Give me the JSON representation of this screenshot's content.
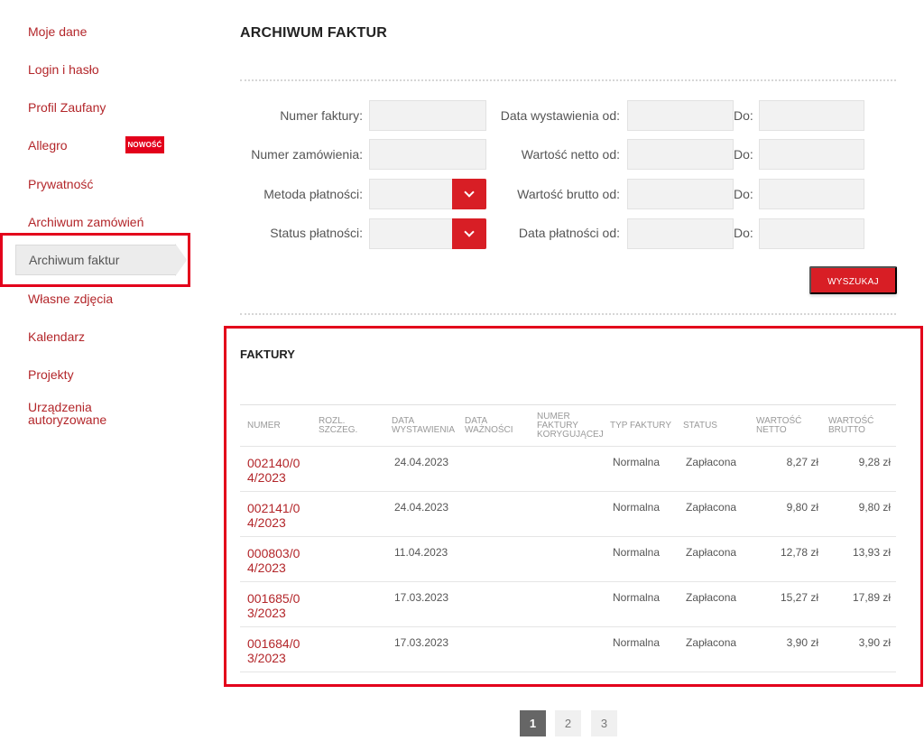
{
  "sidebar": {
    "items": [
      {
        "label": "Moje dane"
      },
      {
        "label": "Login i hasło"
      },
      {
        "label": "Profil Zaufany"
      },
      {
        "label": "Allegro",
        "badge": "NOWOŚĆ"
      },
      {
        "label": "Prywatność"
      },
      {
        "label": "Archiwum zamówień"
      },
      {
        "label": "Archiwum faktur",
        "active": true
      },
      {
        "label": "Własne zdjęcia"
      },
      {
        "label": "Kalendarz"
      },
      {
        "label": "Projekty"
      },
      {
        "label": "Urządzenia autoryzowane"
      }
    ]
  },
  "main": {
    "title": "ARCHIWUM FAKTUR",
    "filters": {
      "invoice_number": {
        "label": "Numer faktury:",
        "value": ""
      },
      "order_number": {
        "label": "Numer zamówienia:",
        "value": ""
      },
      "payment_method": {
        "label": "Metoda płatności:",
        "value": ""
      },
      "payment_status": {
        "label": "Status płatności:",
        "value": ""
      },
      "issue_date_from": {
        "label": "Data wystawienia od:",
        "value": ""
      },
      "net_value_from": {
        "label": "Wartość netto od:",
        "value": ""
      },
      "gross_value_from": {
        "label": "Wartość brutto od:",
        "value": ""
      },
      "payment_date_from": {
        "label": "Data płatności od:",
        "value": ""
      },
      "to_label": "Do:"
    },
    "search_button": "WYSZUKAJ",
    "invoices": {
      "title": "FAKTURY",
      "columns": {
        "number": "NUMER",
        "settlement_1": "ROZL.",
        "settlement_2": "SZCZEG.",
        "issue_date_1": "DATA",
        "issue_date_2": "WYSTAWIENIA",
        "due_date_1": "DATA",
        "due_date_2": "WAŻNOŚCI",
        "correcting_1": "NUMER",
        "correcting_2": "FAKTURY",
        "correcting_3": "KORYGUJĄCEJ",
        "type": "TYP FAKTURY",
        "status": "STATUS",
        "net_1": "WARTOŚĆ",
        "net_2": "NETTO",
        "gross_1": "WARTOŚĆ",
        "gross_2": "BRUTTO"
      },
      "rows": [
        {
          "number_1": "002140/0",
          "number_2": "4/2023",
          "issue_date": "24.04.2023",
          "type": "Normalna",
          "status": "Zapłacona",
          "net": "8,27 zł",
          "gross": "9,28 zł"
        },
        {
          "number_1": "002141/0",
          "number_2": "4/2023",
          "issue_date": "24.04.2023",
          "type": "Normalna",
          "status": "Zapłacona",
          "net": "9,80 zł",
          "gross": "9,80 zł"
        },
        {
          "number_1": "000803/0",
          "number_2": "4/2023",
          "issue_date": "11.04.2023",
          "type": "Normalna",
          "status": "Zapłacona",
          "net": "12,78 zł",
          "gross": "13,93 zł"
        },
        {
          "number_1": "001685/0",
          "number_2": "3/2023",
          "issue_date": "17.03.2023",
          "type": "Normalna",
          "status": "Zapłacona",
          "net": "15,27 zł",
          "gross": "17,89 zł"
        },
        {
          "number_1": "001684/0",
          "number_2": "3/2023",
          "issue_date": "17.03.2023",
          "type": "Normalna",
          "status": "Zapłacona",
          "net": "3,90 zł",
          "gross": "3,90 zł"
        }
      ]
    },
    "pagination": {
      "pages": [
        "1",
        "2",
        "3"
      ],
      "current": "1"
    }
  },
  "colors": {
    "accent": "#d81e25",
    "link": "#b3262a",
    "highlight": "#e3001b"
  }
}
